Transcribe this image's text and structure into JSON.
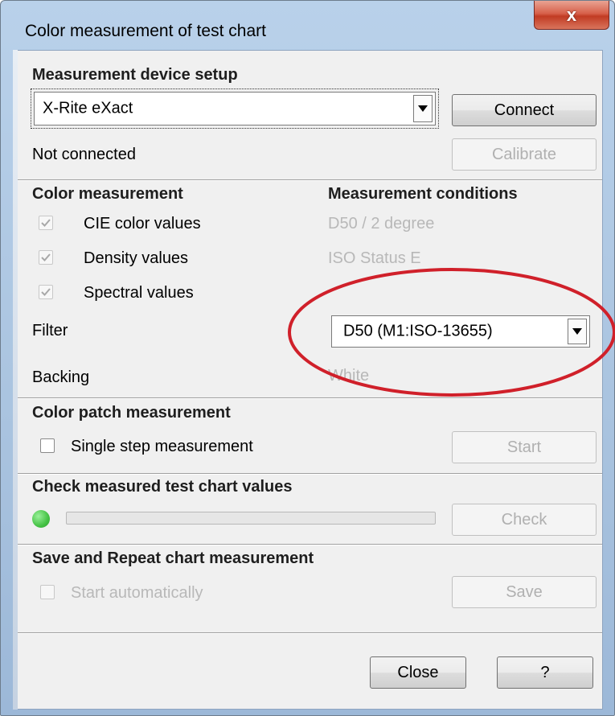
{
  "window": {
    "title": "Color measurement of test chart",
    "close_glyph": "x"
  },
  "device_setup": {
    "section_title": "Measurement device setup",
    "device_selected": "X-Rite eXact",
    "connect_label": "Connect",
    "status": "Not connected",
    "calibrate_label": "Calibrate"
  },
  "color_measurement": {
    "section_title": "Color measurement",
    "cie_label": "CIE color values",
    "cie_checked": true,
    "density_label": "Density values",
    "density_checked": true,
    "spectral_label": "Spectral values",
    "spectral_checked": true
  },
  "measurement_conditions": {
    "section_title": "Measurement conditions",
    "illuminant": "D50 / 2 degree",
    "status": "ISO Status E",
    "filter_label": "Filter",
    "filter_value": "D50  (M1:ISO-13655)",
    "backing_label": "Backing",
    "backing_value": "White"
  },
  "patch_measurement": {
    "section_title": "Color patch measurement",
    "single_step_label": "Single step measurement",
    "single_step_checked": false,
    "start_label": "Start"
  },
  "check_values": {
    "section_title": "Check measured test chart values",
    "progress": 0,
    "check_label": "Check"
  },
  "save_repeat": {
    "section_title": "Save and Repeat chart measurement",
    "start_auto_label": "Start automatically",
    "start_auto_checked": false,
    "save_label": "Save"
  },
  "footer": {
    "close_label": "Close",
    "help_label": "?"
  },
  "colors": {
    "annotation_circle": "#d0202a",
    "status_led": "#45c245"
  },
  "icons": {
    "window_close": "close-icon",
    "combo_arrow": "chevron-down-icon",
    "check": "checkmark-icon",
    "led": "status-led-icon"
  }
}
